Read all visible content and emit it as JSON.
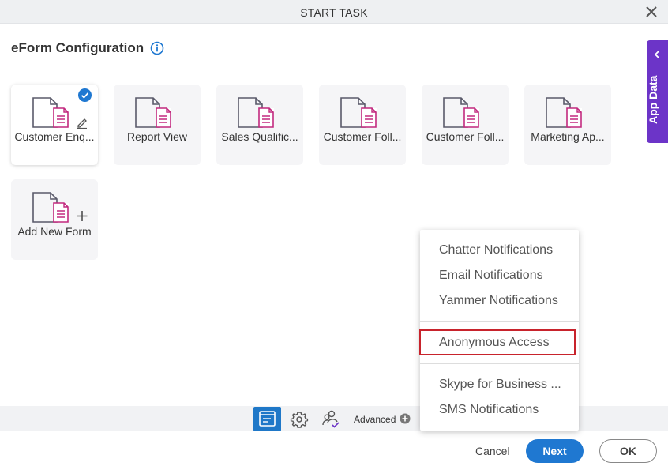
{
  "window": {
    "title": "START TASK"
  },
  "header": {
    "title": "eForm Configuration"
  },
  "forms": [
    {
      "label": "Customer Enq..."
    },
    {
      "label": "Report View"
    },
    {
      "label": "Sales Qualific..."
    },
    {
      "label": "Customer Foll..."
    },
    {
      "label": "Customer Foll..."
    },
    {
      "label": "Marketing Ap..."
    }
  ],
  "add_form": {
    "label": "Add New Form"
  },
  "app_data": {
    "label": "App Data"
  },
  "toolbar": {
    "advanced_label": "Advanced"
  },
  "menu": {
    "items": [
      "Chatter Notifications",
      "Email Notifications",
      "Yammer Notifications",
      "Anonymous Access",
      "Skype for Business ...",
      "SMS Notifications"
    ]
  },
  "footer": {
    "cancel": "Cancel",
    "next": "Next",
    "ok": "OK"
  },
  "colors": {
    "primary": "#1f78d1",
    "purple": "#6c34c8",
    "highlight": "#c8232c",
    "doc_accent": "#c2297f"
  }
}
